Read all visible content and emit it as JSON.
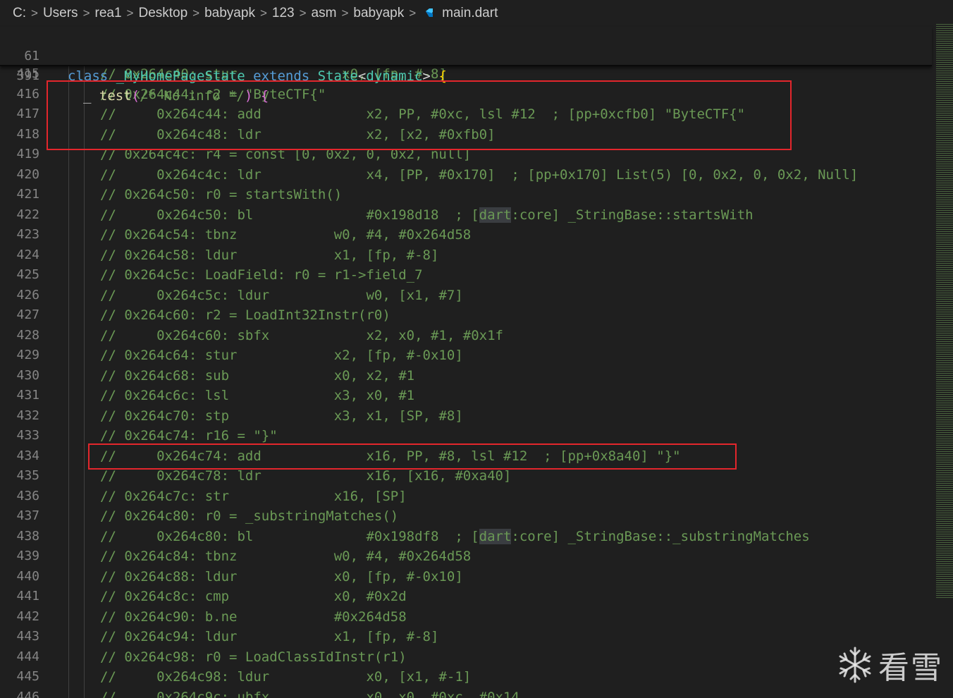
{
  "breadcrumb": {
    "items": [
      "C:",
      "Users",
      "rea1",
      "Desktop",
      "babyapk",
      "123",
      "asm",
      "babyapk"
    ],
    "file": "main.dart",
    "file_icon": "dart-file-icon",
    "separator": ">"
  },
  "sticky_scroll": [
    {
      "line_number": "61",
      "kw": "class",
      "name": "_MyHomePageState",
      "kw2": "extends",
      "base": "State",
      "lt": "<",
      "generic": "dynamic",
      "gt": ">",
      "brace": "{"
    },
    {
      "line_number": "391",
      "prefix": "_ ",
      "fn": "test",
      "popen": "(",
      "comment": "/* No info */",
      "pclose": ")",
      "brace": "{"
    }
  ],
  "code_lines": [
    {
      "n": "415",
      "t": "// 0x264c40: stur             x0, [fp, #-8]"
    },
    {
      "n": "416",
      "t": "// 0x264c44: r2 = \"ByteCTF{\""
    },
    {
      "n": "417",
      "t": "//     0x264c44: add             x2, PP, #0xc, lsl #12  ; [pp+0xcfb0] \"ByteCTF{\""
    },
    {
      "n": "418",
      "t": "//     0x264c48: ldr             x2, [x2, #0xfb0]"
    },
    {
      "n": "419",
      "t": "// 0x264c4c: r4 = const [0, 0x2, 0, 0x2, null]"
    },
    {
      "n": "420",
      "t": "//     0x264c4c: ldr             x4, [PP, #0x170]  ; [pp+0x170] List(5) [0, 0x2, 0, 0x2, Null]"
    },
    {
      "n": "421",
      "t": "// 0x264c50: r0 = startsWith()"
    },
    {
      "n": "422",
      "pre": "//     0x264c50: bl              #0x198d18  ; [",
      "hl": "dart",
      "post": ":core] _StringBase::startsWith"
    },
    {
      "n": "423",
      "t": "// 0x264c54: tbnz            w0, #4, #0x264d58"
    },
    {
      "n": "424",
      "t": "// 0x264c58: ldur            x1, [fp, #-8]"
    },
    {
      "n": "425",
      "t": "// 0x264c5c: LoadField: r0 = r1->field_7"
    },
    {
      "n": "426",
      "t": "//     0x264c5c: ldur            w0, [x1, #7]"
    },
    {
      "n": "427",
      "t": "// 0x264c60: r2 = LoadInt32Instr(r0)"
    },
    {
      "n": "428",
      "t": "//     0x264c60: sbfx            x2, x0, #1, #0x1f"
    },
    {
      "n": "429",
      "t": "// 0x264c64: stur            x2, [fp, #-0x10]"
    },
    {
      "n": "430",
      "t": "// 0x264c68: sub             x0, x2, #1"
    },
    {
      "n": "431",
      "t": "// 0x264c6c: lsl             x3, x0, #1"
    },
    {
      "n": "432",
      "t": "// 0x264c70: stp             x3, x1, [SP, #8]"
    },
    {
      "n": "433",
      "t": "// 0x264c74: r16 = \"}\""
    },
    {
      "n": "434",
      "t": "//     0x264c74: add             x16, PP, #8, lsl #12  ; [pp+0x8a40] \"}\""
    },
    {
      "n": "435",
      "t": "//     0x264c78: ldr             x16, [x16, #0xa40]"
    },
    {
      "n": "436",
      "t": "// 0x264c7c: str             x16, [SP]"
    },
    {
      "n": "437",
      "t": "// 0x264c80: r0 = _substringMatches()"
    },
    {
      "n": "438",
      "pre": "//     0x264c80: bl              #0x198df8  ; [",
      "hl": "dart",
      "post": ":core] _StringBase::_substringMatches"
    },
    {
      "n": "439",
      "t": "// 0x264c84: tbnz            w0, #4, #0x264d58"
    },
    {
      "n": "440",
      "t": "// 0x264c88: ldur            x0, [fp, #-0x10]"
    },
    {
      "n": "441",
      "t": "// 0x264c8c: cmp             x0, #0x2d"
    },
    {
      "n": "442",
      "t": "// 0x264c90: b.ne            #0x264d58"
    },
    {
      "n": "443",
      "t": "// 0x264c94: ldur            x1, [fp, #-8]"
    },
    {
      "n": "444",
      "t": "// 0x264c98: r0 = LoadClassIdInstr(r1)"
    },
    {
      "n": "445",
      "t": "//     0x264c98: ldur            x0, [x1, #-1]"
    },
    {
      "n": "446",
      "t": "//     0x264c9c: ubfx            x0, x0, #0xc, #0x14"
    }
  ],
  "watermark": {
    "text": "看雪",
    "icon": "snowflake-icon"
  },
  "colors": {
    "background": "#1f1f1f",
    "comment": "#6a9955",
    "keyword": "#569cd6",
    "type": "#4ec9b0",
    "function": "#dcdcaa",
    "line_number": "#858585",
    "annotation_box": "#e3262c"
  }
}
